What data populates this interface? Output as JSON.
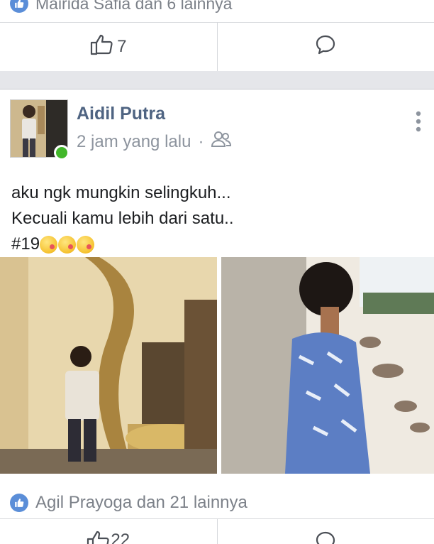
{
  "previous_post": {
    "reaction_text": "Mairida Safia dan 6 lainnya",
    "like_count": "7"
  },
  "post": {
    "author": "Aidil Putra",
    "time": "2 jam yang lalu",
    "separator": "·",
    "text_line1": "aku ngk mungkin selingkuh...",
    "text_line2": "Kecuali kamu lebih dari satu..",
    "hashtag": "#19",
    "reaction_text": "Agil Prayoga dan 21 lainnya",
    "like_count": "22"
  },
  "colors": {
    "author": "#4f6482",
    "meta": "#8d949e",
    "like_bubble": "#5b8ed8",
    "online": "#42b72a"
  }
}
